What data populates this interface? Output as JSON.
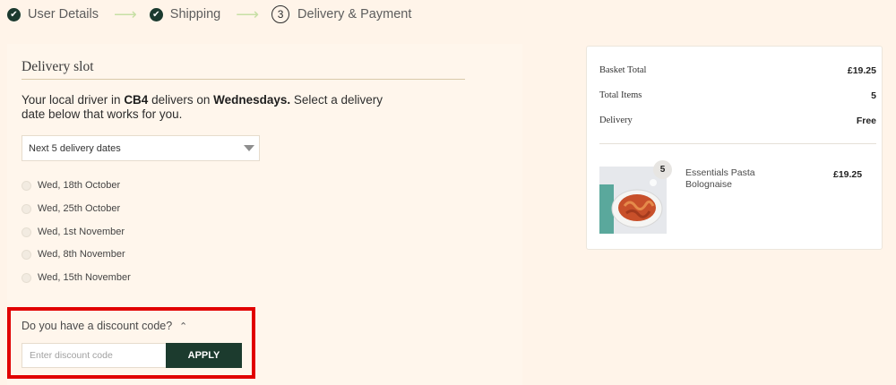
{
  "stepper": {
    "steps": [
      {
        "label": "User Details",
        "state": "done"
      },
      {
        "label": "Shipping",
        "state": "done"
      },
      {
        "label": "Delivery & Payment",
        "state": "current",
        "number": "3"
      }
    ],
    "arrow": "⟶"
  },
  "delivery": {
    "title": "Delivery slot",
    "info_prefix": "Your local driver in ",
    "postcode": "CB4",
    "info_mid": " delivers on ",
    "day": "Wednesdays.",
    "info_suffix": " Select a delivery date below that works for you.",
    "select_value": "Next 5 delivery dates",
    "dates": [
      "Wed, 18th October",
      "Wed, 25th October",
      "Wed, 1st November",
      "Wed, 8th November",
      "Wed, 15th November"
    ]
  },
  "discount": {
    "question": "Do you have a discount code?",
    "chevron": "⌃",
    "placeholder": "Enter discount code",
    "apply_label": "APPLY"
  },
  "summary": {
    "basket_total_label": "Basket Total",
    "basket_total_value": "£19.25",
    "total_items_label": "Total Items",
    "total_items_value": "5",
    "delivery_label": "Delivery",
    "delivery_value": "Free",
    "product": {
      "quantity": "5",
      "name": "Essentials Pasta Bolognaise",
      "price": "£19.25"
    }
  },
  "colors": {
    "accent_green": "#1c3b2e",
    "highlight_red": "#e10000",
    "page_bg": "#fff4e9"
  }
}
